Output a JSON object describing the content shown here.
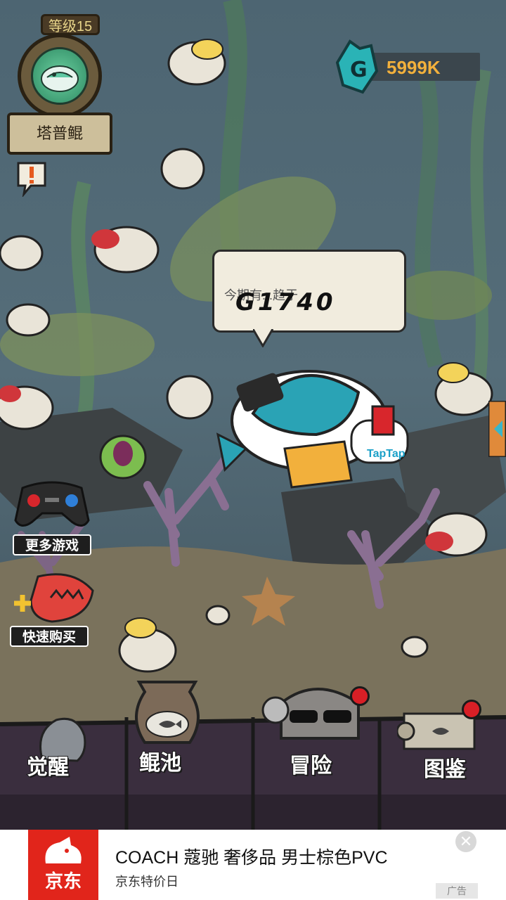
{
  "hud": {
    "level_label": "等级15",
    "player_name": "塔普鲲",
    "currency_value": "5999K",
    "currency_icon": "crystal-g-icon"
  },
  "speech_bubble": {
    "hint_text": "今期有...趋于",
    "value": "G1740"
  },
  "side_menu": {
    "more_games_label": "更多游戏",
    "quick_buy_label": "快速购买"
  },
  "bottom_nav": {
    "items": [
      {
        "label": "觉醒",
        "icon": "statue-icon",
        "has_badge": false
      },
      {
        "label": "鲲池",
        "icon": "fishbowl-icon",
        "has_badge": false
      },
      {
        "label": "冒险",
        "icon": "skull-sunglasses-icon",
        "has_badge": true
      },
      {
        "label": "图鉴",
        "icon": "scroll-icon",
        "has_badge": true
      }
    ]
  },
  "mascot": {
    "brand_text": "TapTap"
  },
  "ad": {
    "brand": "京东",
    "title": "COACH 蔻驰 奢侈品 男士棕色PVC",
    "subtitle": "京东特价日",
    "tag": "广告",
    "close_symbol": "✕"
  },
  "colors": {
    "water": "#556d79",
    "wood_dark": "#2a2113",
    "currency_gold": "#f2b03c",
    "badge_red": "#d81f26",
    "ad_red": "#e1251b"
  }
}
